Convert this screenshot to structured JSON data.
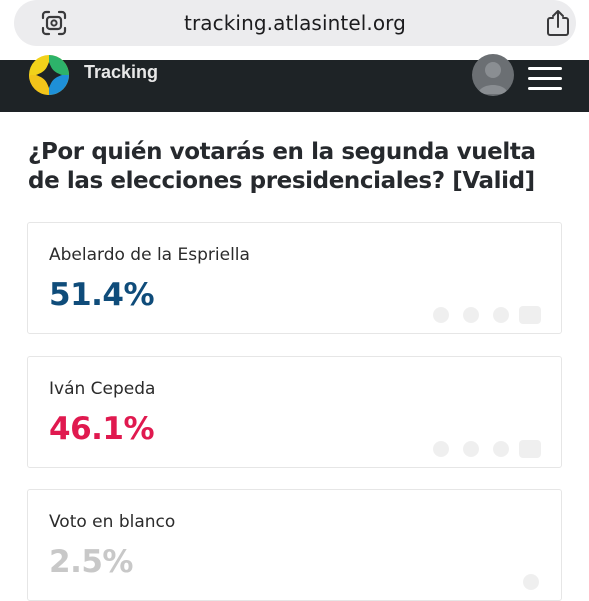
{
  "browser": {
    "url": "tracking.atlasintel.org"
  },
  "header": {
    "brand": "Tracking"
  },
  "poll": {
    "question": "¿Por quién votarás en la segunda vuelta de las elecciones presidenciales? [Valid]",
    "options": [
      {
        "name": "Abelardo de la Espriella",
        "value": "51.4%",
        "color": "#0f4c7a"
      },
      {
        "name": "Iván Cepeda",
        "value": "46.1%",
        "color": "#e0194f"
      },
      {
        "name": "Voto en blanco",
        "value": "2.5%",
        "color": "#c8c8c8"
      }
    ]
  },
  "colors": {
    "header_bg": "#1e2326",
    "url_pill_bg": "#ececee"
  }
}
